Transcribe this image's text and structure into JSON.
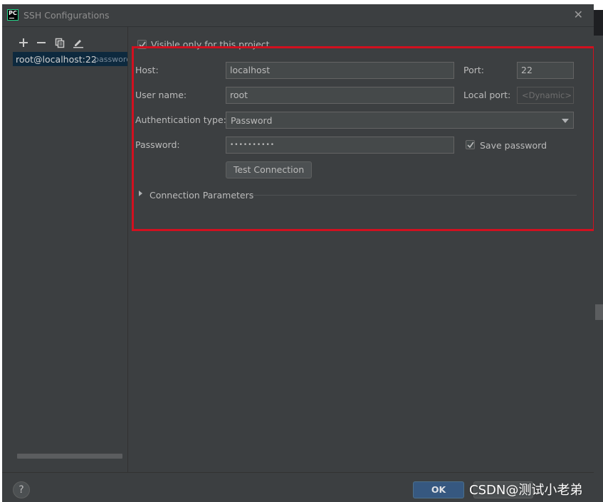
{
  "window": {
    "app_icon_text": "PC",
    "title": "SSH Configurations",
    "close_glyph": "✕"
  },
  "toolbar": {
    "add_icon": "plus-icon",
    "remove_icon": "minus-icon",
    "copy_icon": "copy-icon",
    "edit_icon": "pencil-icon"
  },
  "configs": [
    {
      "name": "root@localhost:22",
      "auth": "password"
    }
  ],
  "form": {
    "visible_only_label": "Visible only for this project",
    "visible_only_checked": true,
    "host_label": "Host:",
    "host_value": "localhost",
    "port_label": "Port:",
    "port_value": "22",
    "username_label": "User name:",
    "username_value": "root",
    "local_port_label": "Local port:",
    "local_port_placeholder": "<Dynamic>",
    "auth_type_label": "Authentication type:",
    "auth_type_value": "Password",
    "password_label": "Password:",
    "password_value": "••••••••••",
    "save_password_label": "Save password",
    "save_password_checked": true,
    "test_connection_label": "Test Connection",
    "connection_params_label": "Connection Parameters"
  },
  "footer": {
    "help_label": "?",
    "ok_label": "OK",
    "cancel_label": ""
  },
  "watermark": "CSDN@测试小老弟",
  "colors": {
    "window_bg": "#3c3f41",
    "selection": "#0d293e",
    "ok_button": "#365880",
    "highlight_box": "#d2101f"
  }
}
